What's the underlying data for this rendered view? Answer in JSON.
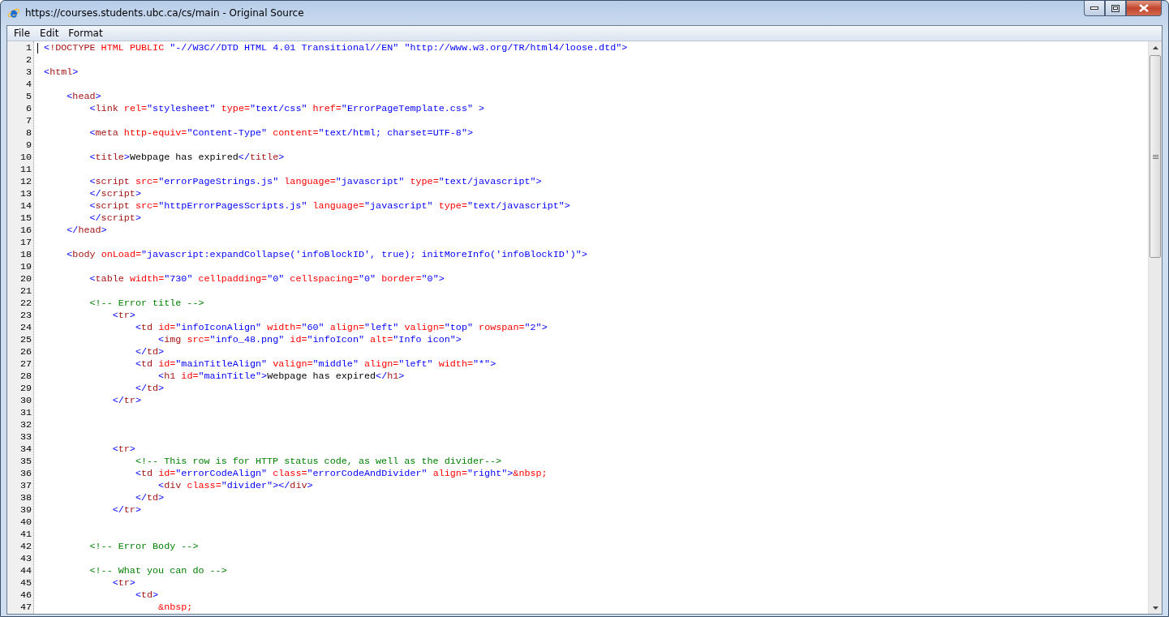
{
  "window": {
    "title": "https://courses.students.ubc.ca/cs/main - Original Source"
  },
  "menu": [
    "File",
    "Edit",
    "Format"
  ],
  "code_lines": [
    {
      "number": "1",
      "text": "<!DOCTYPE HTML PUBLIC \"-//W3C//DTD HTML 4.01 Transitional//EN\" \"http://www.w3.org/TR/html4/loose.dtd\">"
    },
    {
      "number": "2"
    },
    {
      "number": "3",
      "text": "<html>"
    },
    {
      "number": "4"
    },
    {
      "number": "5",
      "text": "    <head>"
    },
    {
      "number": "6",
      "text": "        <link rel=\"stylesheet\" type=\"text/css\" href=\"ErrorPageTemplate.css\" >"
    },
    {
      "number": "7"
    },
    {
      "number": "8",
      "text": "        <meta http-equiv=\"Content-Type\" content=\"text/html; charset=UTF-8\">"
    },
    {
      "number": "9"
    },
    {
      "number": "10",
      "text": "        <title>Webpage has expired</title>"
    },
    {
      "number": "11"
    },
    {
      "number": "12",
      "text": "        <script src=\"errorPageStrings.js\" language=\"javascript\" type=\"text/javascript\">"
    },
    {
      "number": "13",
      "text": "        </script>"
    },
    {
      "number": "14",
      "text": "        <script src=\"httpErrorPagesScripts.js\" language=\"javascript\" type=\"text/javascript\">"
    },
    {
      "number": "15",
      "text": "        </script>"
    },
    {
      "number": "16",
      "text": "    </head>"
    },
    {
      "number": "17"
    },
    {
      "number": "18",
      "text": "    <body onLoad=\"javascript:expandCollapse('infoBlockID', true); initMoreInfo('infoBlockID')\">"
    },
    {
      "number": "19"
    },
    {
      "number": "20",
      "text": "        <table width=\"730\" cellpadding=\"0\" cellspacing=\"0\" border=\"0\">"
    },
    {
      "number": "21"
    },
    {
      "number": "22",
      "text": "        <!-- Error title -->"
    },
    {
      "number": "23",
      "text": "            <tr>"
    },
    {
      "number": "24",
      "text": "                <td id=\"infoIconAlign\" width=\"60\" align=\"left\" valign=\"top\" rowspan=\"2\">"
    },
    {
      "number": "25",
      "text": "                    <img src=\"info_48.png\" id=\"infoIcon\" alt=\"Info icon\">"
    },
    {
      "number": "26",
      "text": "                </td>"
    },
    {
      "number": "27",
      "text": "                <td id=\"mainTitleAlign\" valign=\"middle\" align=\"left\" width=\"*\">"
    },
    {
      "number": "28",
      "text": "                    <h1 id=\"mainTitle\">Webpage has expired</h1>"
    },
    {
      "number": "29",
      "text": "                </td>"
    },
    {
      "number": "30",
      "text": "            </tr>"
    },
    {
      "number": "31"
    },
    {
      "number": "32"
    },
    {
      "number": "33"
    },
    {
      "number": "34",
      "text": "            <tr>"
    },
    {
      "number": "35",
      "text": "                <!-- This row is for HTTP status code, as well as the divider-->"
    },
    {
      "number": "36",
      "text": "                <td id=\"errorCodeAlign\" class=\"errorCodeAndDivider\" align=\"right\">&nbsp;"
    },
    {
      "number": "37",
      "text": "                    <div class=\"divider\"></div>"
    },
    {
      "number": "38",
      "text": "                </td>"
    },
    {
      "number": "39",
      "text": "            </tr>"
    },
    {
      "number": "40"
    },
    {
      "number": "41"
    },
    {
      "number": "42",
      "text": "        <!-- Error Body -->"
    },
    {
      "number": "43"
    },
    {
      "number": "44",
      "text": "        <!-- What you can do -->"
    },
    {
      "number": "45",
      "text": "            <tr>"
    },
    {
      "number": "46",
      "text": "                <td>"
    },
    {
      "number": "47",
      "text": "                    &nbsp;"
    }
  ]
}
